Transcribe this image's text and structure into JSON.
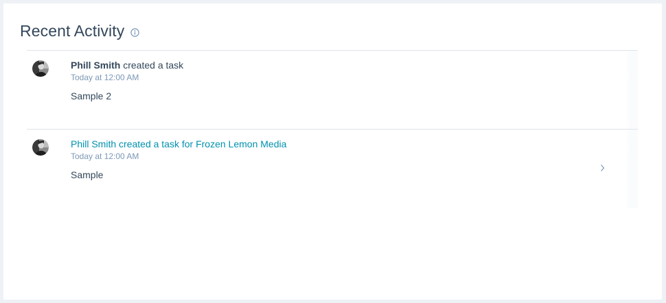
{
  "card": {
    "title": "Recent Activity",
    "info_icon": "info-circle-icon"
  },
  "activities": [
    {
      "actor": "Phill Smith",
      "action": " created a task",
      "timestamp": "Today at 12:00 AM",
      "body": "Sample 2",
      "is_link": false
    },
    {
      "actor": "Phill Smith",
      "action": " created a task for Frozen Lemon Media",
      "timestamp": "Today at 12:00 AM",
      "body": "Sample",
      "is_link": true,
      "chevron_icon": "chevron-right-icon"
    }
  ],
  "colors": {
    "title": "#33475b",
    "link": "#0091ae",
    "muted": "#7c98b6",
    "divider": "#dfe3eb"
  }
}
